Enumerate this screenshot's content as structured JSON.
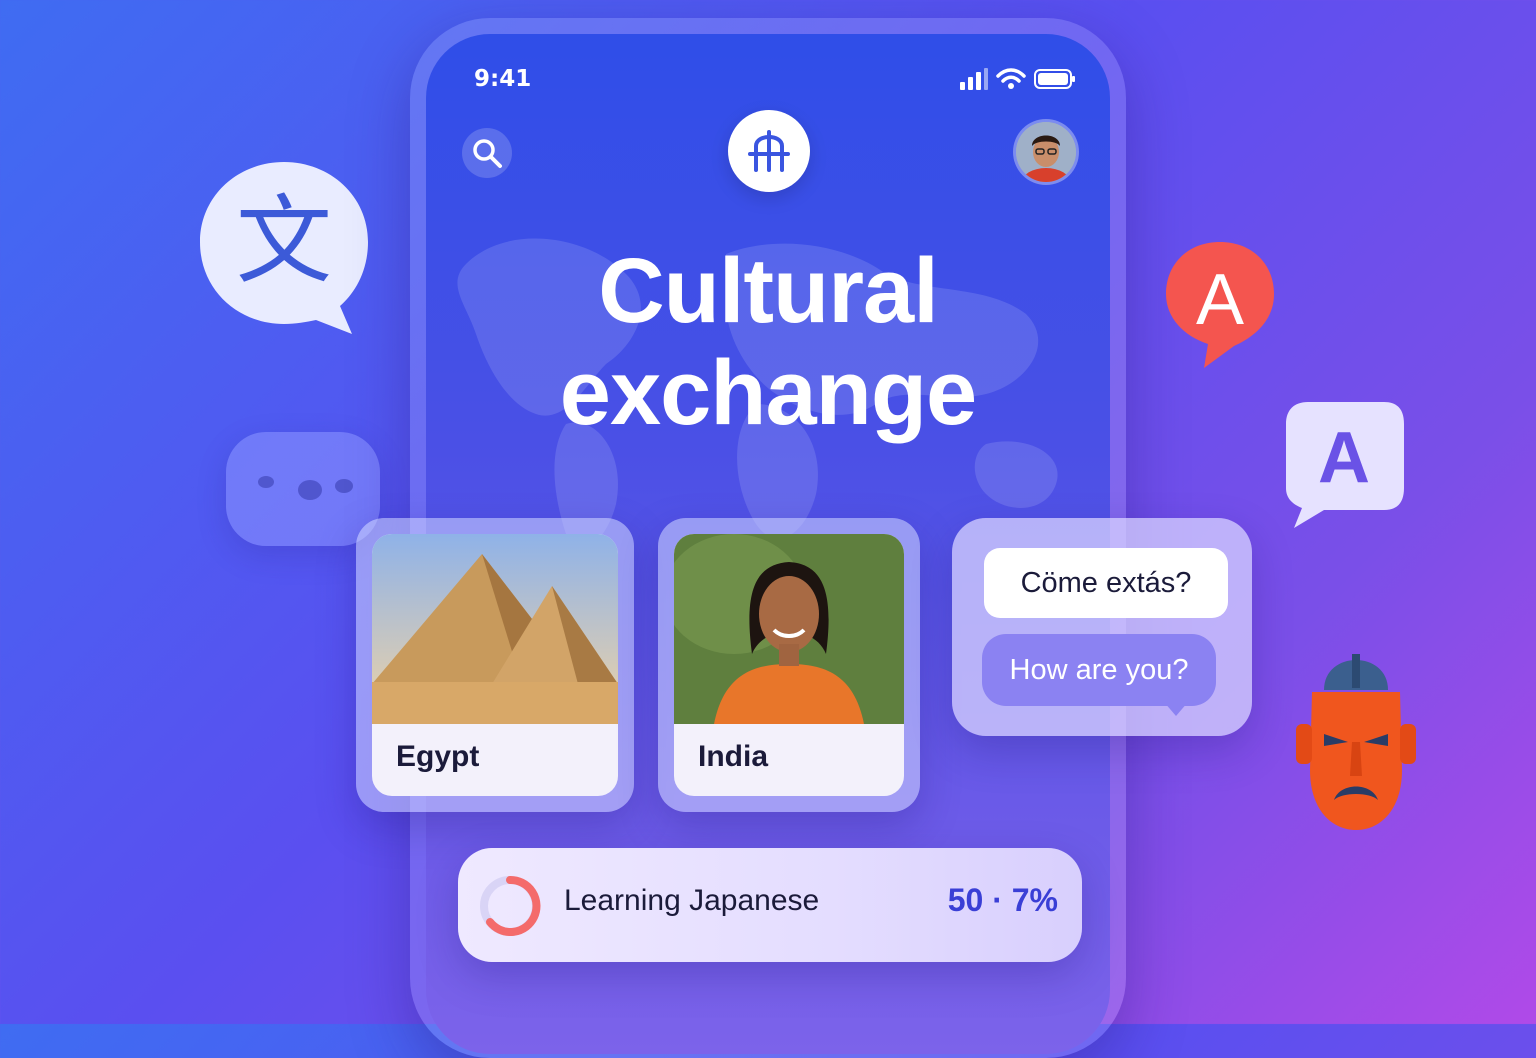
{
  "status_bar": {
    "time": "9:41"
  },
  "header": {
    "title_line1": "Cultural",
    "title_line2": "exchange"
  },
  "cards": [
    {
      "label": "Egypt"
    },
    {
      "label": "India"
    }
  ],
  "chat": {
    "message_original": "Cöme extás?",
    "message_translated": "How are you?"
  },
  "progress": {
    "label": "Learning Japanese",
    "value_text": "50 · 7%"
  },
  "floating_glyphs": {
    "wen": "文",
    "a_red": "A",
    "a_purple": "A"
  },
  "colors": {
    "accent": "#3a3fd6",
    "pin_red": "#f4554f",
    "mask_orange": "#f0561e"
  },
  "icons": [
    "search-icon",
    "app-logo-icon",
    "signal-icon",
    "wifi-icon",
    "battery-icon"
  ]
}
